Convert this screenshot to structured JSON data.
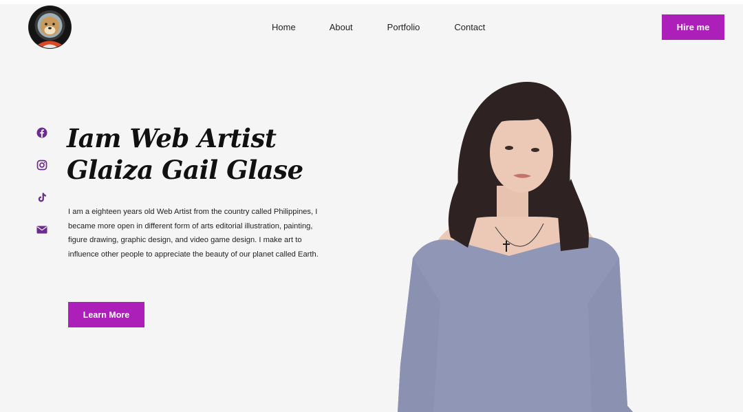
{
  "header": {
    "nav": [
      "Home",
      "About",
      "Portfolio",
      "Contact"
    ],
    "hire_label": "Hire me"
  },
  "social": [
    "facebook-icon",
    "instagram-icon",
    "tiktok-icon",
    "envelope-icon"
  ],
  "hero": {
    "heading_line1": "Iam Web Artist",
    "heading_line2": "Glaiza Gail Glase",
    "description": "I am a eighteen years old Web Artist from the country called Philippines, I became more open in different form of arts editorial illustration, painting, figure drawing, graphic design, and video game design. I make art to influence other people to appreciate the beauty of our planet called Earth.",
    "cta_label": "Learn More"
  },
  "colors": {
    "accent": "#ac1fb8",
    "icon": "#6b2c8f",
    "background": "#f5f5f6"
  }
}
